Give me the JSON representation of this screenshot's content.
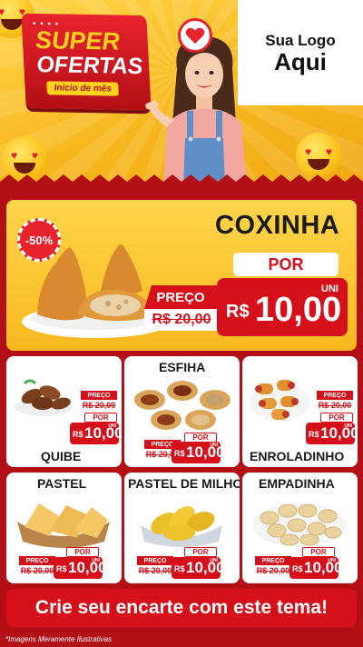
{
  "header": {
    "badge_dots": "• • • •",
    "badge_super": "SUPER",
    "badge_ofertas": "OFERTAS",
    "badge_subtitle": "Início de mês",
    "logo_line1": "Sua Logo",
    "logo_line2": "Aqui"
  },
  "hero": {
    "discount": "-50%",
    "title": "COXINHA",
    "por_label": "POR",
    "old_label": "PREÇO",
    "old_price": "R$ 20,00",
    "unit": "UNI",
    "currency": "R$",
    "new_price": "10,00"
  },
  "price_labels": {
    "preco": "PREÇO",
    "por": "POR",
    "unit": "UNI",
    "currency": "R$",
    "old_price": "R$ 20,00",
    "new_price": "10,00"
  },
  "products": [
    {
      "name": "QUIBE"
    },
    {
      "name": "ESFIHA"
    },
    {
      "name": "ENROLADINHO"
    },
    {
      "name": "PASTEL"
    },
    {
      "name": "PASTEL DE MILHO"
    },
    {
      "name": "EMPADINHA"
    }
  ],
  "footer": {
    "cta": "Crie seu encarte com este tema!",
    "disclaimer": "*Imagens Meramente Ilustrativas"
  },
  "colors": {
    "background_red": "#b30f16",
    "accent_red": "#d6101b",
    "yellow": "#f7b81f",
    "white": "#ffffff"
  }
}
